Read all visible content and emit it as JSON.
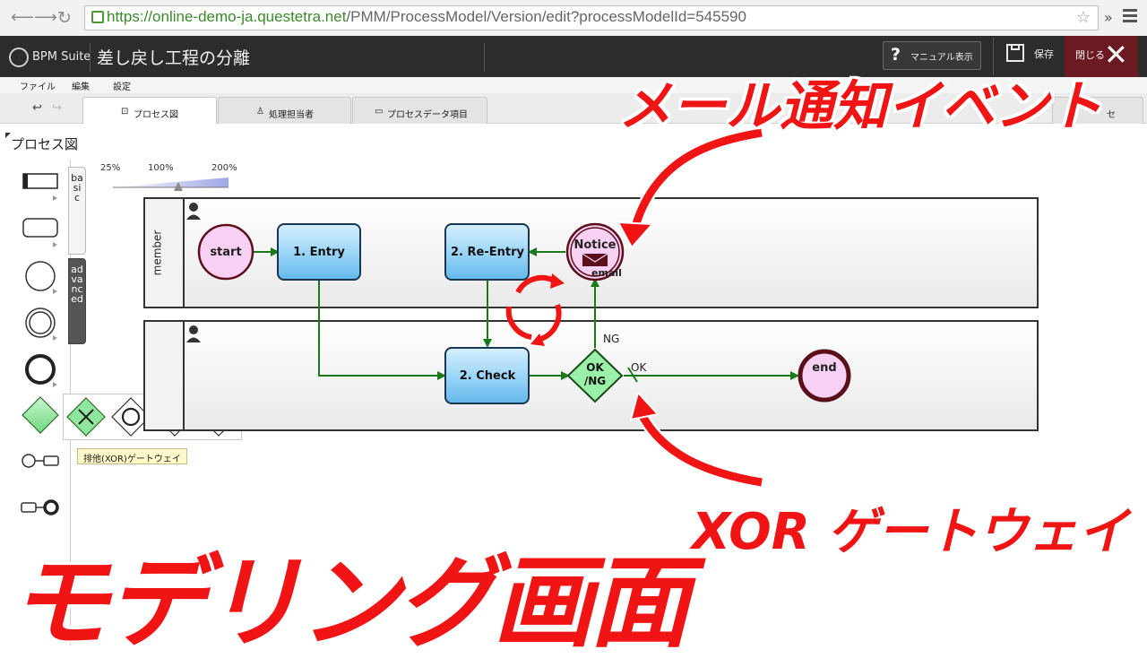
{
  "browser": {
    "url_scheme": "https://",
    "url_host": "online-demo-ja.questetra.net",
    "url_path": "/PMM/ProcessModel/Version/edit?processModelId=545590",
    "more_label": "»"
  },
  "header": {
    "logo_text": "BPM Suite",
    "title": "差し戻し工程の分離",
    "manual_label": "マニュアル表示",
    "save_label": "保存",
    "close_label": "閉じる"
  },
  "menu": {
    "items": [
      "ファイル",
      "編集",
      "設定"
    ]
  },
  "tabs": [
    {
      "label": "プロセス図",
      "icon": "diagram-icon"
    },
    {
      "label": "処理担当者",
      "icon": "user-icon"
    },
    {
      "label": "プロセスデータ項目",
      "icon": "data-icon"
    }
  ],
  "right_tab_text": "セ",
  "canvas": {
    "panel_title": "プロセス図",
    "zoom_labels": [
      "25%",
      "100%",
      "200%"
    ],
    "zoom_level": 1.0,
    "side_tabs": {
      "basic": "basic",
      "advanced": "advanced"
    },
    "tooltip": "排他(XOR)ゲートウェイ"
  },
  "diagram": {
    "lanes": [
      {
        "name": "member"
      },
      {
        "name": ""
      }
    ],
    "nodes": {
      "start": "start",
      "entry": "1. Entry",
      "reentry": "2. Re-Entry",
      "notice": "Notice",
      "notice_sub": "email",
      "check": "2. Check",
      "gateway_top": "OK",
      "gateway_bottom": "/NG",
      "end": "end"
    },
    "edge_labels": {
      "ng": "NG",
      "ok": "OK"
    },
    "colors": {
      "task_fill": "#7ec9f2",
      "flow": "#1a7a1a",
      "event_fill": "#f7d0f3",
      "gateway_fill": "#9af0a8",
      "end_ring": "#5a0f1a"
    }
  },
  "overlays": {
    "mail_event": "メール通知イベント",
    "xor_gateway": "XOR ゲートウェイ",
    "modeling_screen": "モデリング画面",
    "accent": "#f01414"
  }
}
